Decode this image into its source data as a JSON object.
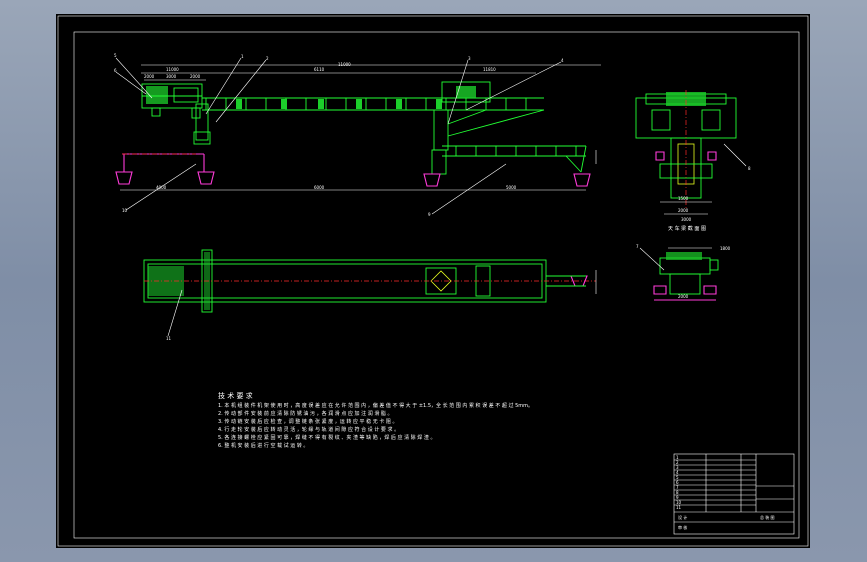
{
  "drawing": {
    "background": "#000000",
    "colors": {
      "structure": "#22ff33",
      "dimension": "#ffffff",
      "wheel": "#ff3bd9",
      "centerline": "#ff2a2a",
      "detail": "#e8ff20"
    },
    "callouts": [
      "1",
      "2",
      "3",
      "4",
      "5",
      "6",
      "7",
      "8",
      "9",
      "10",
      "11"
    ],
    "dims": {
      "top_overall": "11000",
      "top_left_a": "2000",
      "top_left_b": "3000",
      "top_left_c": "2000",
      "top_span": "6110",
      "top_mid": "11000",
      "top_right": "11810",
      "bottom_left": "4000",
      "bottom_mid": "6000",
      "bottom_right": "5000",
      "section_a": "1500",
      "section_b": "2000",
      "section_c": "3000",
      "detail_top": "1800",
      "detail_bottom": "2000"
    },
    "view_label": "天 车 梁 截 面 图",
    "tech_title": "技 术 要 求",
    "tech_notes": [
      "1. 本 机 组 装 件 机 架 使 用 时 ，高 度 误 差 应 在 允 许 范 围 内 ，偏 差 值 不 得 大 于 ±1.5，全 长 范 围 内 累 积 误 差 不 超 过 5mm。",
      "2. 传 动 部 件 安 装 前 应 清 除 防 锈 油 污 ，各 润 滑 点 应 加 注 润 滑 脂 。",
      "3. 传 动 链 安 装 后 应 检 查 ，调 整 链 条 张 紧 度 ，运 转 应 平 稳 无 卡 阻 。",
      "4. 行 走 轮 安 装 后 应 转 动 灵 活 ，轮 缘 与 轨 道 间 隙 应 符 合 设 计 要 求 。",
      "5. 各 连 接 螺 栓 应 紧 固 可 靠 ，焊 缝 不 得 有 裂 纹 、夹 渣 等 缺 陷 ，焊 后 应 清 除 焊 渣 。",
      "6. 整 机 安 装 后 进 行 空 载 试 运 转 。"
    ],
    "title_block": {
      "rows": [
        "1",
        "2",
        "3",
        "4",
        "5",
        "6",
        "7",
        "8",
        "9",
        "10",
        "11"
      ],
      "label_a": "设 计",
      "label_b": "审 核",
      "drawing_name": "总 装 图"
    }
  }
}
